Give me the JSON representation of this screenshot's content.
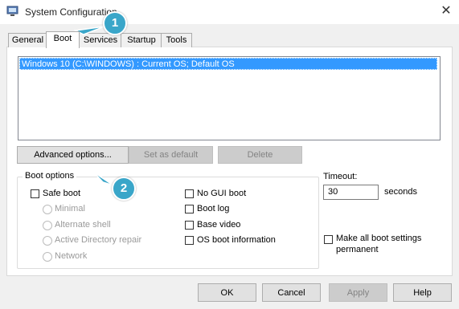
{
  "window": {
    "title": "System Configuration",
    "close_glyph": "✕"
  },
  "tabs": [
    {
      "label": "General",
      "active": false
    },
    {
      "label": "Boot",
      "active": true
    },
    {
      "label": "Services",
      "active": false
    },
    {
      "label": "Startup",
      "active": false
    },
    {
      "label": "Tools",
      "active": false
    }
  ],
  "os_list": {
    "items": [
      "Windows 10 (C:\\WINDOWS) : Current OS; Default OS"
    ]
  },
  "actions": {
    "advanced": "Advanced options...",
    "set_default": "Set as default",
    "delete": "Delete"
  },
  "boot_options": {
    "title": "Boot options",
    "safe_boot": {
      "label": "Safe boot",
      "checked": false
    },
    "safe_modes": [
      {
        "label": "Minimal"
      },
      {
        "label": "Alternate shell"
      },
      {
        "label": "Active Directory repair"
      },
      {
        "label": "Network"
      }
    ],
    "right_checks": [
      {
        "label": "No GUI boot",
        "checked": false
      },
      {
        "label": "Boot log",
        "checked": false
      },
      {
        "label": "Base video",
        "checked": false
      },
      {
        "label": "OS boot information",
        "checked": false
      }
    ]
  },
  "timeout": {
    "label": "Timeout:",
    "value": "30",
    "unit": "seconds"
  },
  "permanent": {
    "label_line1": "Make all boot settings",
    "label_line2": "permanent",
    "checked": false
  },
  "footer": {
    "ok": "OK",
    "cancel": "Cancel",
    "apply": "Apply",
    "help": "Help"
  },
  "callouts": [
    "1",
    "2"
  ],
  "colors": {
    "selection": "#3399ff",
    "callout": "#3aa6c9"
  }
}
